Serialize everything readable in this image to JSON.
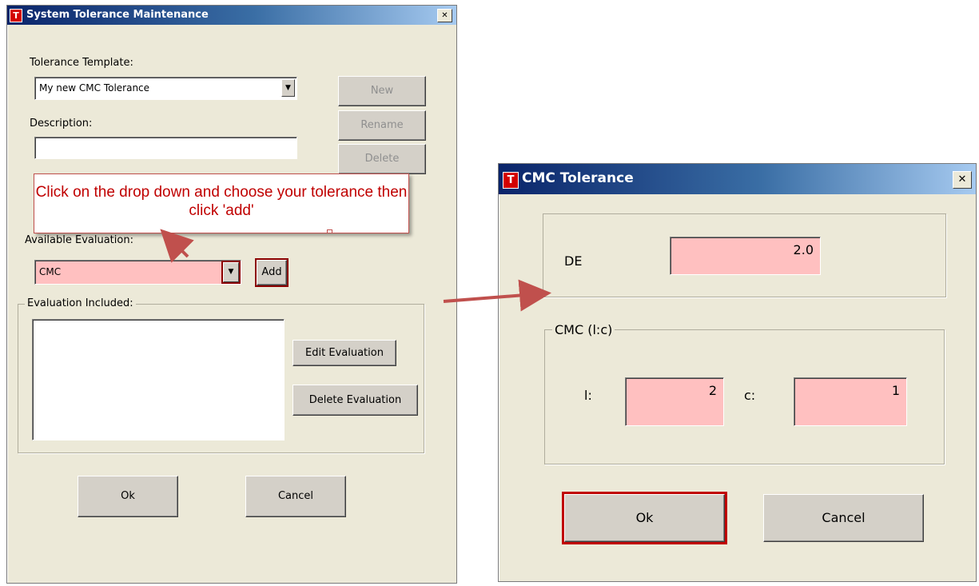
{
  "colors": {
    "titlebar_start": "#0a246a",
    "window_bg": "#ece9d8",
    "required_field": "#ffc0c0",
    "callout_red": "#c0504d",
    "arrow_red": "#c0504d"
  },
  "tolerance_window": {
    "title": "System Tolerance Maintenance",
    "app_icon": "T",
    "close_icon": "✕",
    "template_label": "Tolerance Template:",
    "template_value": "My new CMC Tolerance",
    "description_label": "Description:",
    "description_value": "",
    "new_button": "New",
    "rename_button": "Rename",
    "delete_button": "Delete",
    "available_label": "Available Evaluation:",
    "available_value": "CMC",
    "add_button": "Add",
    "evaluation_group": "Evaluation Included:",
    "edit_evaluation_button": "Edit Evaluation",
    "delete_evaluation_button": "Delete Evaluation",
    "ok_button": "Ok",
    "cancel_button": "Cancel",
    "dropdown_icon": "▼"
  },
  "callout": {
    "text": "Click on the drop down and choose your tolerance then click 'add'"
  },
  "cmc_window": {
    "title": "CMC Tolerance",
    "app_icon": "T",
    "close_icon": "✕",
    "de_label": "DE",
    "de_value": "2.0",
    "cmc_group": "CMC (l:c)",
    "l_label": "l:",
    "l_value": "2",
    "c_label": "c:",
    "c_value": "1",
    "ok_button": "Ok",
    "cancel_button": "Cancel"
  }
}
